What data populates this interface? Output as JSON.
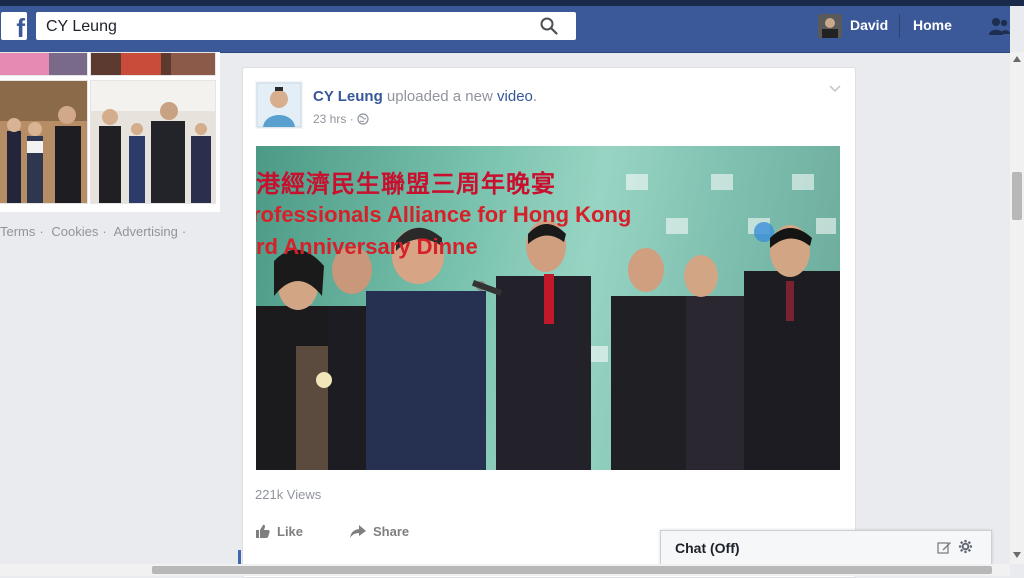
{
  "topbar": {
    "search_value": "CY Leung",
    "user_name": "David",
    "home_label": "Home",
    "logo_letter": "f",
    "bg_color": "#3b5998"
  },
  "sidebar": {
    "footer_links": [
      "Terms",
      "Cookies",
      "Advertising"
    ]
  },
  "post": {
    "author": "CY Leung",
    "action_text": "uploaded a new",
    "object_link": "video",
    "timestamp": "23 hrs",
    "video": {
      "banner_chinese": "港經濟民生聯盟三周年晚宴",
      "banner_english_line1": "rofessionals Alliance for Hong Kong",
      "banner_english_line2": "rd Anniversary Dinne"
    },
    "views": "221k Views",
    "actions": {
      "like_label": "Like",
      "share_label": "Share"
    }
  },
  "chat": {
    "label": "Chat (Off)"
  }
}
